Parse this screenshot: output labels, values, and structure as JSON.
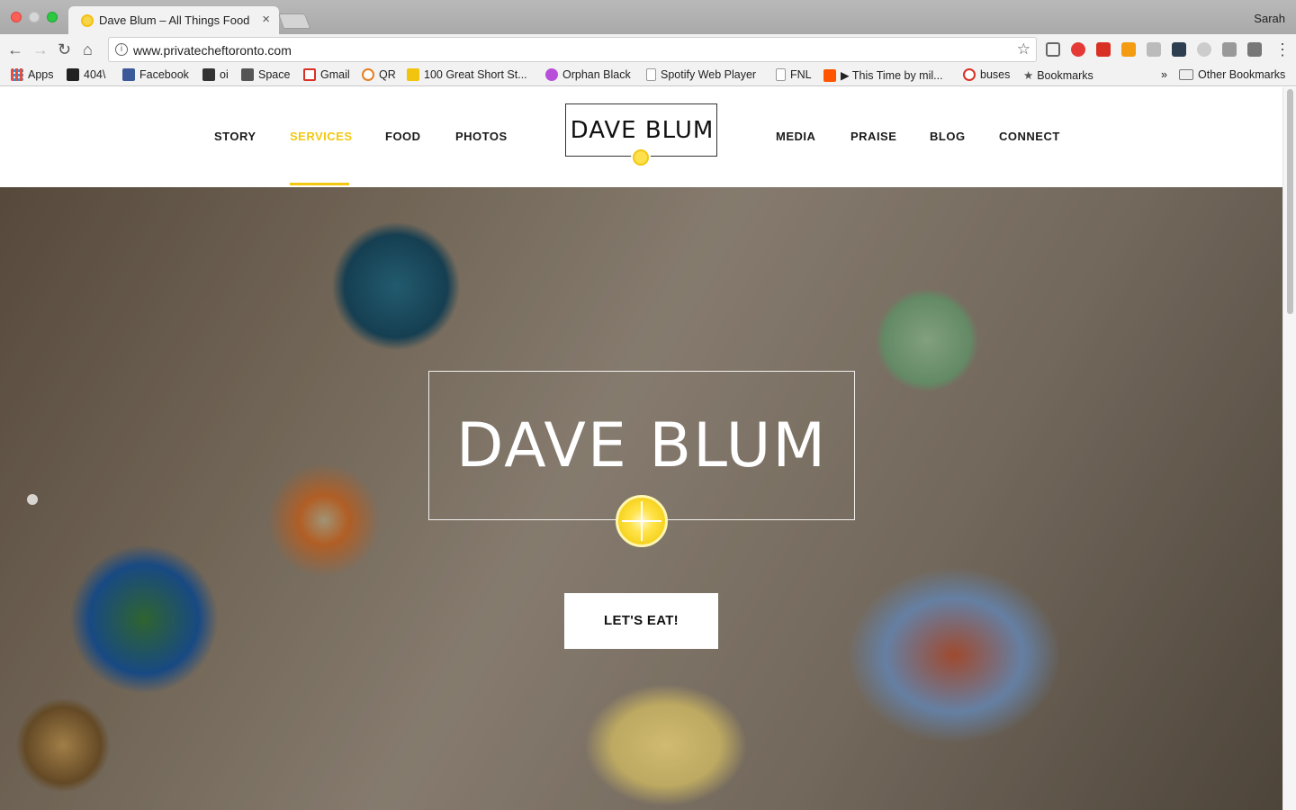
{
  "browser": {
    "tab_title": "Dave Blum – All Things Food",
    "tab_close": "×",
    "profile_name": "Sarah",
    "url": "www.privatecheftoronto.com",
    "nav_icons": {
      "back": "←",
      "forward": "→",
      "reload": "↻",
      "home": "⌂",
      "star": "☆",
      "info": "i"
    },
    "bookmarks": [
      {
        "label": "Apps",
        "icon": "apps-grid-icon",
        "color": "#e74c3c"
      },
      {
        "label": "404\\",
        "icon": "404-icon",
        "color": "#222222"
      },
      {
        "label": "Facebook",
        "icon": "facebook-icon",
        "color": "#3b5998"
      },
      {
        "label": "oi",
        "icon": "oi-icon",
        "color": "#333333"
      },
      {
        "label": "Space",
        "icon": "space-icon",
        "color": "#555555"
      },
      {
        "label": "Gmail",
        "icon": "gmail-icon",
        "color": "#d93025"
      },
      {
        "label": "QR",
        "icon": "qr-icon",
        "color": "#e67e22"
      },
      {
        "label": "100 Great Short St...",
        "icon": "book-icon",
        "color": "#f1c40f"
      },
      {
        "label": "Orphan Black",
        "icon": "play-icon",
        "color": "#b84fd8"
      },
      {
        "label": "Spotify Web Player",
        "icon": "page-icon",
        "color": "#dddddd"
      },
      {
        "label": "FNL",
        "icon": "page-icon",
        "color": "#dddddd"
      },
      {
        "label": "▶ This Time by mil...",
        "icon": "soundcloud-icon",
        "color": "#ff5500"
      },
      {
        "label": "buses",
        "icon": "bus-icon",
        "color": "#d93025"
      },
      {
        "label": "Bookmarks",
        "icon": "star-bookmark-icon",
        "color": "#555555"
      }
    ],
    "overflow_label": "»",
    "other_bookmarks": "Other Bookmarks"
  },
  "site": {
    "nav_left": [
      "STORY",
      "SERVICES",
      "FOOD",
      "PHOTOS"
    ],
    "nav_right": [
      "MEDIA",
      "PRAISE",
      "BLOG",
      "CONNECT"
    ],
    "active_nav": "SERVICES",
    "logo_text": "DAVE  BLUM",
    "hero_title": "DAVE  BLUM",
    "cta_label": "LET'S EAT!",
    "colors": {
      "accent": "#f2c811",
      "text": "#1a1a1a"
    }
  }
}
